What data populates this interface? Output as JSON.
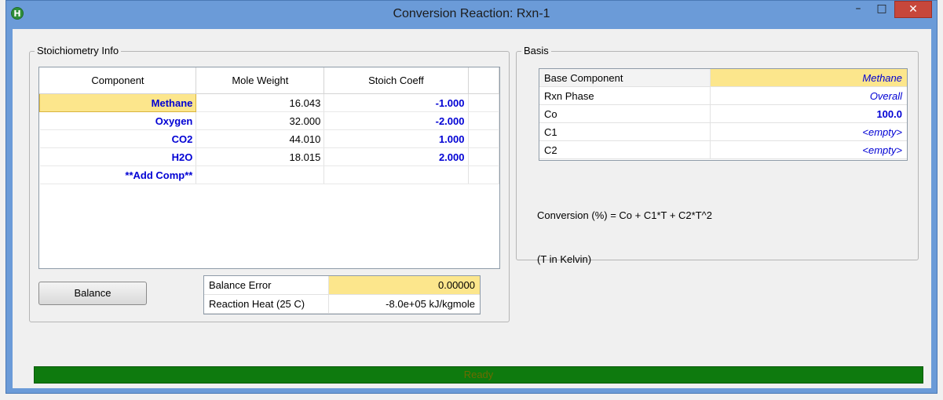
{
  "window": {
    "title": "Conversion Reaction: Rxn-1",
    "app_icon": "H",
    "minimize_glyph": "–",
    "maximize_glyph": "□",
    "close_glyph": "✕"
  },
  "stoichiometry": {
    "legend": "Stoichiometry Info",
    "headers": [
      "Component",
      "Mole Weight",
      "Stoich Coeff"
    ],
    "rows": [
      {
        "component": "Methane",
        "mole_weight": "16.043",
        "stoich_coeff": "-1.000"
      },
      {
        "component": "Oxygen",
        "mole_weight": "32.000",
        "stoich_coeff": "-2.000"
      },
      {
        "component": "CO2",
        "mole_weight": "44.010",
        "stoich_coeff": "1.000"
      },
      {
        "component": "H2O",
        "mole_weight": "18.015",
        "stoich_coeff": "2.000"
      },
      {
        "component": "**Add Comp**",
        "mole_weight": "",
        "stoich_coeff": ""
      }
    ],
    "balance_button": "Balance",
    "balance_error_label": "Balance Error",
    "balance_error_value": "0.00000",
    "reaction_heat_label": "Reaction Heat (25 C)",
    "reaction_heat_value": "-8.0e+05 kJ/kgmole"
  },
  "basis": {
    "legend": "Basis",
    "rows": [
      {
        "label": "Base Component",
        "value": "Methane"
      },
      {
        "label": "Rxn Phase",
        "value": "Overall"
      },
      {
        "label": "Co",
        "value": "100.0"
      },
      {
        "label": "C1",
        "value": "<empty>"
      },
      {
        "label": "C2",
        "value": "<empty>"
      }
    ],
    "formula": "Conversion (%) = Co + C1*T + C2*T^2",
    "temperature_units": "(T in Kelvin)"
  },
  "status": {
    "text": "Ready",
    "color": "#0e7a0e"
  },
  "colors": {
    "highlight": "#fce68c",
    "link_blue": "#0000d4",
    "title_bar": "#6b9bd8",
    "close_red": "#c7473b"
  }
}
